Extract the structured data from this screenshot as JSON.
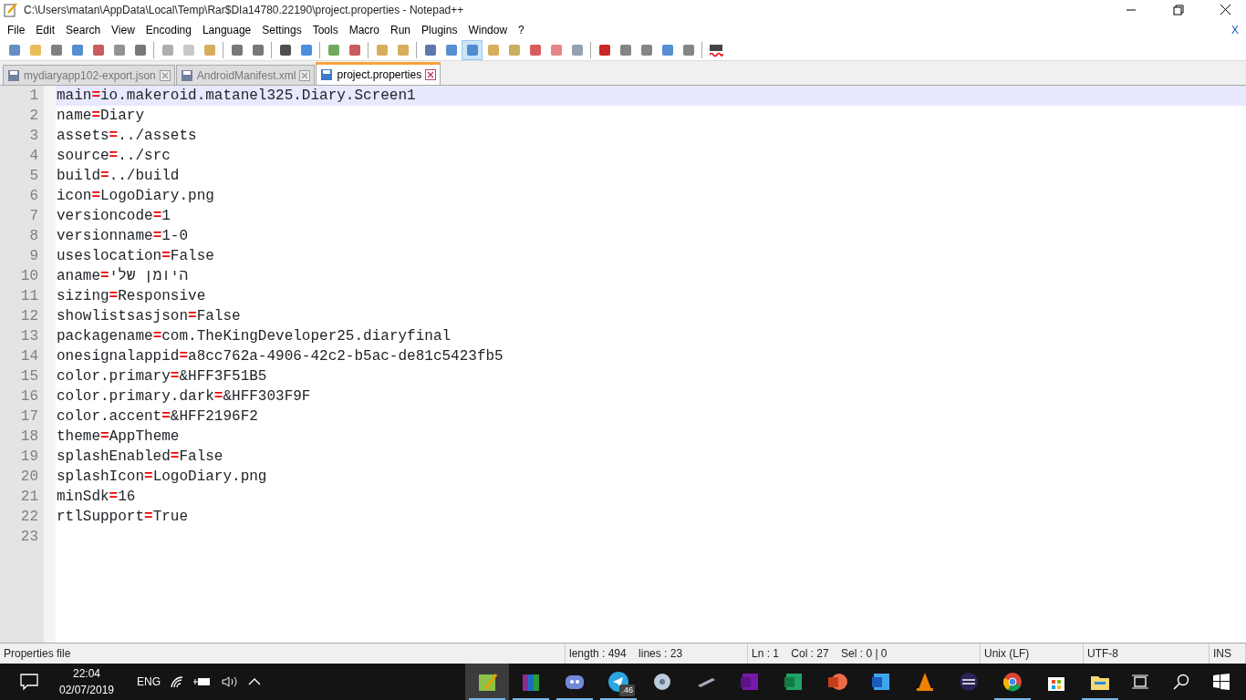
{
  "window": {
    "title": "C:\\Users\\matan\\AppData\\Local\\Temp\\Rar$DIa14780.22190\\project.properties - Notepad++"
  },
  "menu": [
    "File",
    "Edit",
    "Search",
    "View",
    "Encoding",
    "Language",
    "Settings",
    "Tools",
    "Macro",
    "Run",
    "Plugins",
    "Window",
    "?"
  ],
  "menu_close": "X",
  "toolbar": [
    [
      {
        "pressed": false
      },
      {
        "pressed": false
      },
      {
        "pressed": false
      },
      {
        "pressed": false
      },
      {
        "pressed": false
      },
      {
        "pressed": false
      },
      {
        "pressed": false
      }
    ],
    [
      {
        "pressed": false
      },
      {
        "pressed": false
      },
      {
        "pressed": false
      }
    ],
    [
      {
        "pressed": false
      },
      {
        "pressed": false
      }
    ],
    [
      {
        "pressed": false
      },
      {
        "pressed": false
      }
    ],
    [
      {
        "pressed": false
      },
      {
        "pressed": false
      }
    ],
    [
      {
        "pressed": false
      },
      {
        "pressed": false
      }
    ],
    [
      {
        "pressed": false
      },
      {
        "pressed": false
      },
      {
        "pressed": true
      },
      {
        "pressed": false
      },
      {
        "pressed": false
      },
      {
        "pressed": false
      },
      {
        "pressed": false
      },
      {
        "pressed": false
      }
    ],
    [
      {
        "pressed": false
      },
      {
        "pressed": false
      },
      {
        "pressed": false
      },
      {
        "pressed": false
      },
      {
        "pressed": false
      }
    ],
    [
      {
        "pressed": false
      }
    ]
  ],
  "tabs": [
    {
      "label": "mydiaryapp102-export.json",
      "selected": false
    },
    {
      "label": "AndroidManifest.xml",
      "selected": false
    },
    {
      "label": "project.properties",
      "selected": true
    }
  ],
  "editor": {
    "lines": [
      {
        "number": "1",
        "key": "main",
        "op": "=",
        "value": "io.makeroid.matanel325.Diary.Screen1",
        "current": true
      },
      {
        "number": "2",
        "key": "name",
        "op": "=",
        "value": "Diary",
        "current": false
      },
      {
        "number": "3",
        "key": "assets",
        "op": "=",
        "value": "../assets",
        "current": false
      },
      {
        "number": "4",
        "key": "source",
        "op": "=",
        "value": "../src",
        "current": false
      },
      {
        "number": "5",
        "key": "build",
        "op": "=",
        "value": "../build",
        "current": false
      },
      {
        "number": "6",
        "key": "icon",
        "op": "=",
        "value": "LogoDiary.png",
        "current": false
      },
      {
        "number": "7",
        "key": "versioncode",
        "op": "=",
        "value": "1",
        "current": false
      },
      {
        "number": "8",
        "key": "versionname",
        "op": "=",
        "value": "1-0",
        "current": false
      },
      {
        "number": "9",
        "key": "useslocation",
        "op": "=",
        "value": "False",
        "current": false
      },
      {
        "number": "10",
        "key": "aname",
        "op": "=",
        "value": "היומן שלי",
        "current": false
      },
      {
        "number": "11",
        "key": "sizing",
        "op": "=",
        "value": "Responsive",
        "current": false
      },
      {
        "number": "12",
        "key": "showlistsasjson",
        "op": "=",
        "value": "False",
        "current": false
      },
      {
        "number": "13",
        "key": "packagename",
        "op": "=",
        "value": "com.TheKingDeveloper25.diaryfinal",
        "current": false
      },
      {
        "number": "14",
        "key": "onesignalappid",
        "op": "=",
        "value": "a8cc762a-4906-42c2-b5ac-de81c5423fb5",
        "current": false
      },
      {
        "number": "15",
        "key": "color.primary",
        "op": "=",
        "value": "&HFF3F51B5",
        "current": false
      },
      {
        "number": "16",
        "key": "color.primary.dark",
        "op": "=",
        "value": "&HFF303F9F",
        "current": false
      },
      {
        "number": "17",
        "key": "color.accent",
        "op": "=",
        "value": "&HFF2196F2",
        "current": false
      },
      {
        "number": "18",
        "key": "theme",
        "op": "=",
        "value": "AppTheme",
        "current": false
      },
      {
        "number": "19",
        "key": "splashEnabled",
        "op": "=",
        "value": "False",
        "current": false
      },
      {
        "number": "20",
        "key": "splashIcon",
        "op": "=",
        "value": "LogoDiary.png",
        "current": false
      },
      {
        "number": "21",
        "key": "minSdk",
        "op": "=",
        "value": "16",
        "current": false
      },
      {
        "number": "22",
        "key": "rtlSupport",
        "op": "=",
        "value": "True",
        "current": false
      },
      {
        "number": "23",
        "current": false
      }
    ]
  },
  "status_bar": [
    "Properties file",
    "length : 494    lines : 23",
    "Ln : 1    Col : 27    Sel : 0 | 0",
    "Unix (LF)",
    "UTF-8",
    "INS"
  ],
  "taskbar": {
    "time": "22:04",
    "date": "02/07/2019",
    "language": "ENG",
    "apps": [
      {
        "running": true,
        "active": true
      },
      {
        "running": true,
        "active": false
      },
      {
        "running": true,
        "active": false
      },
      {
        "running": true,
        "active": false,
        "badge": ".46"
      },
      {
        "running": false,
        "active": false
      },
      {
        "running": false,
        "active": false
      },
      {
        "running": false,
        "active": false
      },
      {
        "running": false,
        "active": false
      },
      {
        "running": false,
        "active": false
      },
      {
        "running": false,
        "active": false
      },
      {
        "running": false,
        "active": false
      },
      {
        "running": false,
        "active": false
      },
      {
        "running": true,
        "active": false
      },
      {
        "running": false,
        "active": false
      },
      {
        "running": true,
        "active": false
      }
    ]
  }
}
